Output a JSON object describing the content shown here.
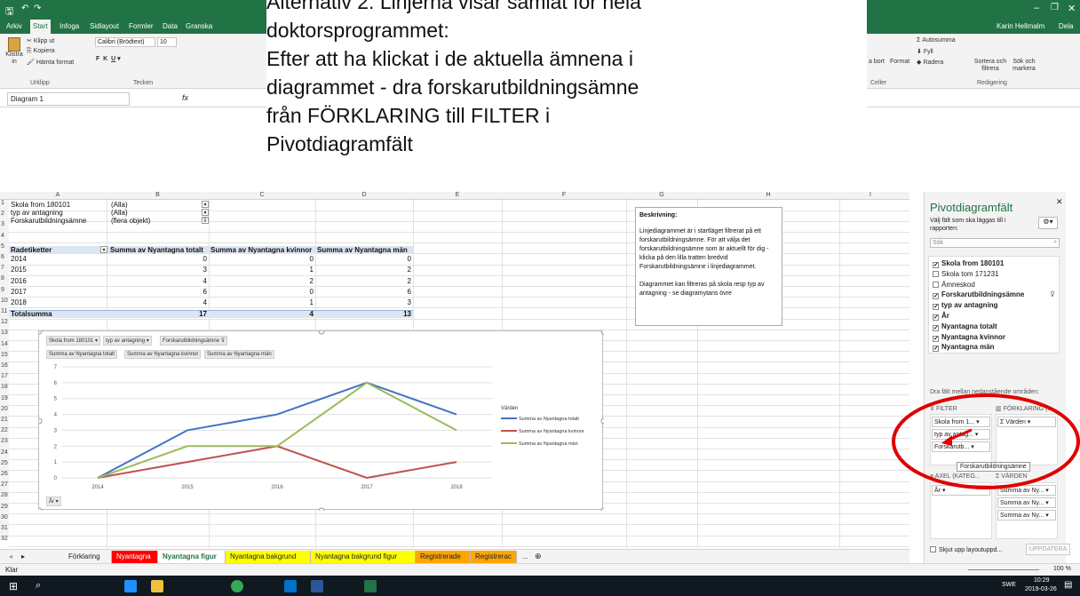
{
  "window": {
    "user": "Karin Hellmalm",
    "share": "Dela"
  },
  "ribbon_tabs": [
    "Arkiv",
    "Start",
    "Infoga",
    "Sidlayout",
    "Formler",
    "Data",
    "Granska"
  ],
  "ribbon": {
    "clipboard": {
      "paste": "Klistra in",
      "cut": "Klipp ut",
      "copy": "Kopiera",
      "format_painter": "Hämta format",
      "group": "Urklipp"
    },
    "font": {
      "name": "Calibri (Brödtext)",
      "size": "10",
      "group": "Tecken"
    },
    "cells": {
      "delete": "a bort",
      "format": "Format",
      "group": "Celler"
    },
    "editing": {
      "autosum": "Autosumma",
      "fill": "Fyll",
      "clear": "Radera",
      "sort": "Sortera och filtrera",
      "find": "Sök och markera",
      "group": "Redigering"
    }
  },
  "namebox": "Diagram 1",
  "overlay": [
    "Alternativ 2: Linjerna visar samlat för hela",
    "doktorsprogrammet:",
    "Efter att ha klickat i de aktuella ämnena i",
    "diagrammet - dra forskarutbildningsämne",
    "från FÖRKLARING till FILTER i",
    "Pivotdiagramfält"
  ],
  "columns": [
    "A",
    "B",
    "C",
    "D",
    "E",
    "F",
    "G",
    "H",
    "I"
  ],
  "rows": [
    "1",
    "2",
    "3",
    "4",
    "5",
    "6",
    "7",
    "8",
    "9",
    "10",
    "11",
    "12",
    "13",
    "14",
    "15",
    "16",
    "17",
    "18",
    "19",
    "20",
    "21",
    "22",
    "23",
    "24",
    "25",
    "26",
    "27",
    "28",
    "29",
    "30",
    "31",
    "32"
  ],
  "filters": [
    {
      "label": "Skola from 180101",
      "value": "(Alla)"
    },
    {
      "label": "typ av antagning",
      "value": "(Alla)"
    },
    {
      "label": "Forskarutbildningsämne",
      "value": "(flera objekt)"
    }
  ],
  "table": {
    "headers": [
      "Radetiketter",
      "Summa av Nyantagna totalt",
      "Summa av Nyantagna kvinnor",
      "Summa av Nyantagna män"
    ],
    "rows": [
      [
        "2014",
        "0",
        "0",
        "0"
      ],
      [
        "2015",
        "3",
        "1",
        "2"
      ],
      [
        "2016",
        "4",
        "2",
        "2"
      ],
      [
        "2017",
        "6",
        "0",
        "6"
      ],
      [
        "2018",
        "4",
        "1",
        "3"
      ]
    ],
    "total": [
      "Totalsumma",
      "17",
      "4",
      "13"
    ]
  },
  "textbox": {
    "title": "Beskrivning:",
    "p1": "Linjediagrammet är i startläget filtrerat på ett forskarutbildningsämne. För att välja det forskarutbildningsämne som är aktuellt för dig - klicka på den lilla tratten bredvid Forskarutbildningsämne i linjediagrammet.",
    "p2": "Diagrammet kan filtreras på skola resp typ av antagning - se diagramytans övre"
  },
  "chart_buttons": {
    "filters": [
      "Skola from 180101",
      "typ av antagning",
      "Forskarutbildningsämne"
    ],
    "values": [
      "Summa av Nyantagna totalt",
      "Summa av Nyantagna kvinnor",
      "Summa av Nyantagna män"
    ],
    "axis": "År"
  },
  "chart_data": {
    "type": "line",
    "categories": [
      "2014",
      "2015",
      "2016",
      "2017",
      "2018"
    ],
    "series": [
      {
        "name": "Summa av Nyantagna totalt",
        "values": [
          0,
          3,
          4,
          6,
          4
        ],
        "color": "#4472c4"
      },
      {
        "name": "Summa av Nyantagna kvinnor",
        "values": [
          0,
          1,
          2,
          0,
          1
        ],
        "color": "#c0504d"
      },
      {
        "name": "Summa av Nyantagna män",
        "values": [
          0,
          2,
          2,
          6,
          3
        ],
        "color": "#9bbb59"
      }
    ],
    "yticks": [
      "0",
      "1",
      "2",
      "3",
      "4",
      "5",
      "6",
      "7"
    ],
    "ylim": [
      0,
      7
    ],
    "legend_title": "Värden",
    "legend": "right",
    "grid": true
  },
  "pivot": {
    "title": "Pivotdiagramfält",
    "subtitle": "Välj fält som ska läggas till i rapporten:",
    "search": "Sök",
    "fields": [
      {
        "label": "Skola from 180101",
        "checked": "✓"
      },
      {
        "label": "Skola tom 171231",
        "checked": ""
      },
      {
        "label": "Ämneskod",
        "checked": ""
      },
      {
        "label": "Forskarutbildningsämne",
        "checked": "✓"
      },
      {
        "label": "typ av antagning",
        "checked": "✓"
      },
      {
        "label": "År",
        "checked": "✓"
      },
      {
        "label": "Nyantagna totalt",
        "checked": "✓"
      },
      {
        "label": "Nyantagna kvinnor",
        "checked": "✓"
      },
      {
        "label": "Nyantagna män",
        "checked": "✓"
      }
    ],
    "drag_hint": "Dra fält mellan nedanstående områden:",
    "filter_label": "FILTER",
    "legend_label": "FÖRKLARING (...",
    "filter_items": [
      "Skola from 1...",
      "typ av antag...",
      "Forskarutb..."
    ],
    "legend_items": [
      "Värden"
    ],
    "tooltip": "Forskarutbildningsämne",
    "axis_label": "AXEL (KATEG...",
    "values_label": "VÄRDEN",
    "axis_items": [
      "År"
    ],
    "values_items": [
      "Summa av Ny...",
      "Summa av Ny...",
      "Summa av Ny..."
    ],
    "defer": "Skjut upp layoutuppd...",
    "update": "UPPDATERA"
  },
  "sheets": [
    {
      "label": "Förklaring",
      "color": "#f3f3f3"
    },
    {
      "label": "Nyantagna",
      "color": "#ff0000"
    },
    {
      "label": "Nyantagna figur",
      "color": "#ffffff"
    },
    {
      "label": "Nyantagna bakgrund",
      "color": "#ffff00"
    },
    {
      "label": "Nyantagna bakgrund figur",
      "color": "#ffff00"
    },
    {
      "label": "Registrerade",
      "color": "#ffa500"
    },
    {
      "label": "Registrerac",
      "color": "#ffa500"
    }
  ],
  "status": {
    "ready": "Klar",
    "zoom": "100 %"
  },
  "taskbar": {
    "lang": "SWE",
    "time": "10:29",
    "date": "2019-03-26"
  }
}
